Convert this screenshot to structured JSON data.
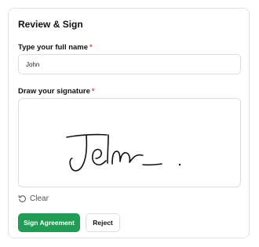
{
  "card": {
    "title": "Review & Sign"
  },
  "name_field": {
    "label": "Type your full name",
    "required_marker": "*",
    "value": "John"
  },
  "signature_field": {
    "label": "Draw your signature",
    "required_marker": "*",
    "clear_label": "Clear"
  },
  "actions": {
    "sign_label": "Sign Agreement",
    "reject_label": "Reject"
  },
  "icons": {
    "clear": "rotate-ccw-icon"
  },
  "colors": {
    "primary": "#1f9d55",
    "required": "#e5484d",
    "ink": "#111111"
  }
}
